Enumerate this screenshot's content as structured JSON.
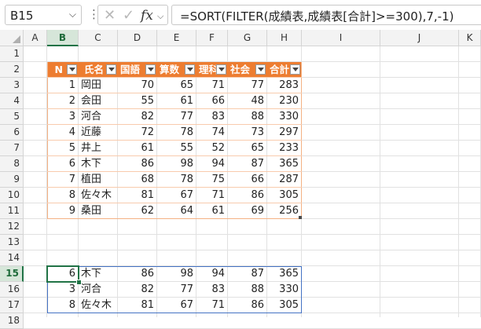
{
  "name_box": {
    "value": "B15"
  },
  "formula_bar": {
    "formula": "=SORT(FILTER(成績表,成績表[合計]>=300),7,-1)",
    "cancel_glyph": "✕",
    "enter_glyph": "✓",
    "fx_glyph": "fx"
  },
  "columns": [
    "A",
    "B",
    "C",
    "D",
    "E",
    "F",
    "G",
    "H",
    "I",
    "J",
    "K"
  ],
  "rows": [
    "1",
    "2",
    "3",
    "4",
    "5",
    "6",
    "7",
    "8",
    "9",
    "10",
    "11",
    "12",
    "13",
    "14",
    "15",
    "16",
    "17",
    "18"
  ],
  "table": {
    "headers": [
      "N",
      "氏名",
      "国語",
      "算数",
      "理科",
      "社会",
      "合計"
    ],
    "rows": [
      [
        "1",
        "岡田",
        "70",
        "65",
        "71",
        "77",
        "283"
      ],
      [
        "2",
        "会田",
        "55",
        "61",
        "66",
        "48",
        "230"
      ],
      [
        "3",
        "河合",
        "82",
        "77",
        "83",
        "88",
        "330"
      ],
      [
        "4",
        "近藤",
        "72",
        "78",
        "74",
        "73",
        "297"
      ],
      [
        "5",
        "井上",
        "61",
        "55",
        "52",
        "65",
        "233"
      ],
      [
        "6",
        "木下",
        "86",
        "98",
        "94",
        "87",
        "365"
      ],
      [
        "7",
        "植田",
        "68",
        "78",
        "75",
        "66",
        "287"
      ],
      [
        "8",
        "佐々木",
        "81",
        "67",
        "71",
        "86",
        "305"
      ],
      [
        "9",
        "桑田",
        "62",
        "64",
        "61",
        "69",
        "256"
      ]
    ]
  },
  "result": {
    "rows": [
      [
        "6",
        "木下",
        "86",
        "98",
        "94",
        "87",
        "365"
      ],
      [
        "3",
        "河合",
        "82",
        "77",
        "83",
        "88",
        "330"
      ],
      [
        "8",
        "佐々木",
        "81",
        "67",
        "71",
        "86",
        "305"
      ]
    ]
  },
  "colors": {
    "table_header": "#ed7d31",
    "table_border": "#f4b183",
    "spill_border": "#4472c4",
    "active_cell": "#217346"
  }
}
